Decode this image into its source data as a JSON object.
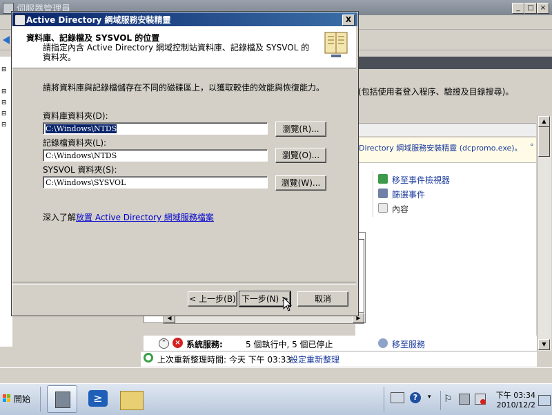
{
  "server_manager": {
    "title": "伺服器管理員",
    "description_tail": "(包括使用者登入程序、驗證及目錄搜尋)。",
    "notice_text": "Directory 網域服務安裝精靈 (dcpromo.exe)。",
    "actions": [
      {
        "label": "移至事件檢視器",
        "icon": "event-viewer-icon"
      },
      {
        "label": "篩選事件",
        "icon": "filter-icon"
      },
      {
        "label": "內容",
        "icon": "properties-icon"
      }
    ],
    "system_services": {
      "label": "系統服務:",
      "status": "5 個執行中, 5 個已停止",
      "action": "移至服務"
    },
    "status_bar": {
      "last_refresh": "上次重新整理時間: 今天 下午 03:33",
      "configure_refresh": "設定重新整理"
    }
  },
  "wizard": {
    "title": "Active Directory 網域服務安裝精靈",
    "close_label": "X",
    "header_title": "資料庫、記錄檔及 SYSVOL 的位置",
    "header_subtitle": "請指定內含 Active Directory 網域控制站資料庫、記錄檔及 SYSVOL 的資料夾。",
    "intro": "請將資料庫與記錄檔儲存在不同的磁碟區上，以獲取較佳的效能與恢復能力。",
    "fields": {
      "database": {
        "label": "資料庫資料夾(D):",
        "value": "C:\\Windows\\NTDS",
        "browse": "瀏覽(R)..."
      },
      "logs": {
        "label": "記錄檔資料夾(L):",
        "value": "C:\\Windows\\NTDS",
        "browse": "瀏覽(O)..."
      },
      "sysvol": {
        "label": "SYSVOL 資料夾(S):",
        "value": "C:\\Windows\\SYSVOL",
        "browse": "瀏覽(W)..."
      }
    },
    "more_prefix": "深入了解",
    "more_link": "放置 Active Directory 網域服務檔案",
    "buttons": {
      "back": "< 上一步(B)",
      "next": "下一步(N) >",
      "cancel": "取消"
    }
  },
  "taskbar": {
    "start_label": "開始",
    "apps": [
      "server-manager-icon",
      "powershell-icon",
      "explorer-folder-icon"
    ],
    "clock_time": "下午 03:34",
    "clock_date": "2010/12/2"
  },
  "colors": {
    "title_active": "#0a246a",
    "link": "#0000cc",
    "dialog_face": "#d4d0c8",
    "desktop": "#3a6ea5"
  }
}
